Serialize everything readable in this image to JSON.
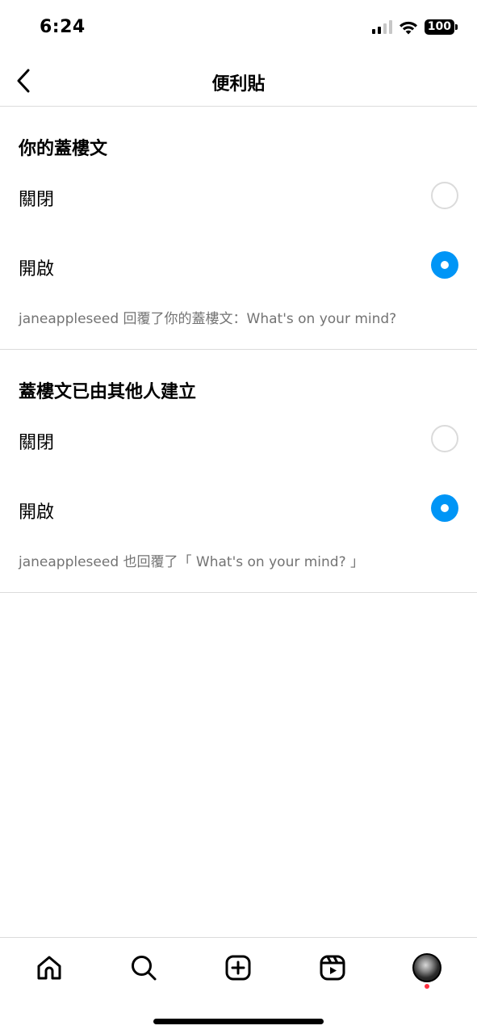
{
  "status_bar": {
    "time": "6:24",
    "battery": "100",
    "icons": [
      "cellular-signal-icon",
      "wifi-icon",
      "battery-icon"
    ]
  },
  "header": {
    "title": "便利貼",
    "back_icon": "chevron-left-icon"
  },
  "sections": [
    {
      "heading": "你的蓋樓文",
      "options": [
        {
          "label": "關閉",
          "selected": false
        },
        {
          "label": "開啟",
          "selected": true
        }
      ],
      "preview": "janeappleseed 回覆了你的蓋樓文：What's on your mind?"
    },
    {
      "heading": "蓋樓文已由其他人建立",
      "options": [
        {
          "label": "關閉",
          "selected": false
        },
        {
          "label": "開啟",
          "selected": true
        }
      ],
      "preview": "janeappleseed 也回覆了「 What's on your mind? 」"
    }
  ],
  "bottom_nav": {
    "items": [
      "home-icon",
      "search-icon",
      "create-icon",
      "reels-icon",
      "profile-avatar"
    ],
    "notification_dot": true
  },
  "colors": {
    "accent": "#0095f6",
    "divider": "#dbdbdb",
    "secondary_text": "#737373",
    "notification": "#ff3040"
  }
}
